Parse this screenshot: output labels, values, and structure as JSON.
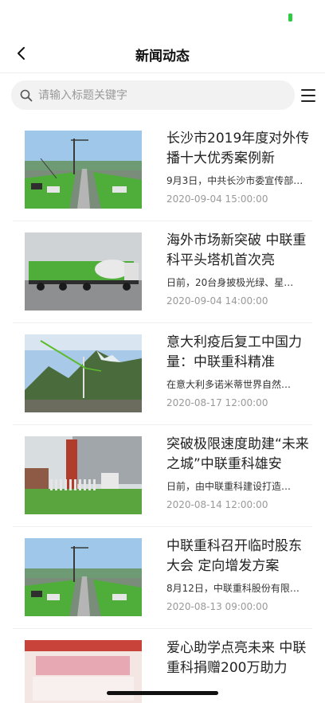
{
  "nav": {
    "title": "新闻动态",
    "back_icon": "chevron-left-icon"
  },
  "search": {
    "placeholder": "请输入标题关键字",
    "icon": "search-icon",
    "menu_icon": "menu-icon"
  },
  "news": [
    {
      "title": "长沙市2019年度对外传播十大优秀案例新",
      "desc": "9月3日，中共长沙市委宣传部…",
      "date": "2020-09-04 15:00:00",
      "thumb": "cranes-lineup-photo"
    },
    {
      "title": "海外市场新突破 中联重科平头塔机首次亮",
      "desc": "日前，20台身披极光绿、星…",
      "date": "2020-09-04 14:00:00",
      "thumb": "mixer-trucks-photo"
    },
    {
      "title": "意大利疫后复工中国力量：中联重科精准",
      "desc": "在意大利多诺米蒂世界自然…",
      "date": "2020-08-17 12:00:00",
      "thumb": "tower-crane-mountain-photo"
    },
    {
      "title": "突破极限速度助建“未来之城”中联重科雄安",
      "desc": "日前，由中联重科建设打造…",
      "date": "2020-08-14 12:00:00",
      "thumb": "workers-site-photo"
    },
    {
      "title": "中联重科召开临时股东大会 定向增发方案",
      "desc": "8月12日，中联重科股份有限…",
      "date": "2020-08-13 09:00:00",
      "thumb": "cranes-lineup-photo"
    },
    {
      "title": "爱心助学点亮未来 中联重科捐赠200万助力",
      "desc": "",
      "date": "",
      "thumb": "donation-event-photo"
    }
  ],
  "colors": {
    "battery": "#2ecc40",
    "brand_green": "#5dbb2e"
  }
}
